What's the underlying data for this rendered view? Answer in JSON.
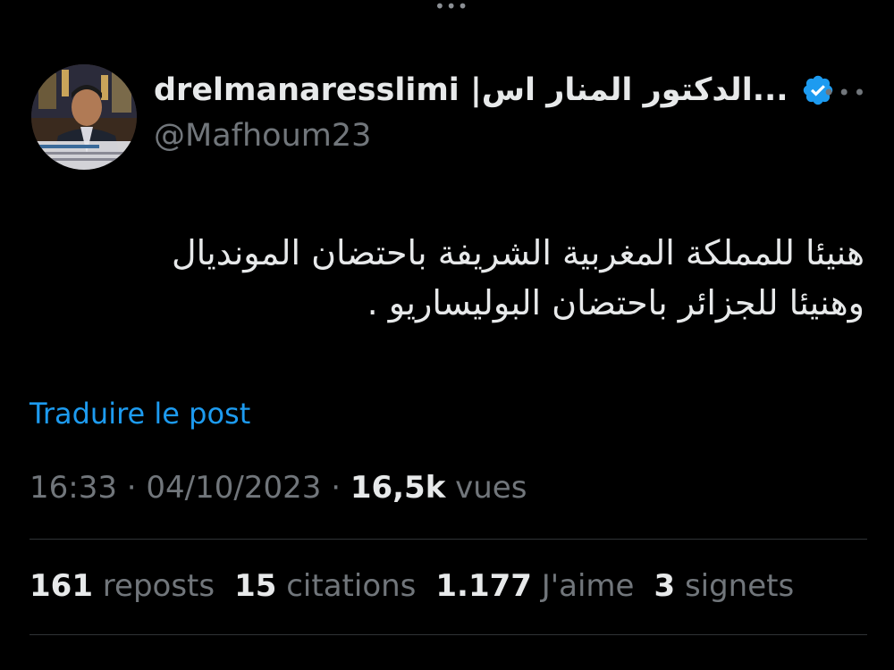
{
  "top_indicator": "•••",
  "author": {
    "display_name": "drelmanaresslimi |الدكتور المنار اس...",
    "handle": "@Mafhoum23",
    "verified": true,
    "verified_color": "#1d9bf0"
  },
  "more_menu": "•••",
  "tweet": {
    "lines": [
      "هنيئا للمملكة المغربية الشريفة باحتضان المونديال",
      "وهنيئا للجزائر باحتضان البوليساريو ."
    ]
  },
  "translate_label": "Traduire le post",
  "meta": {
    "time": "16:33",
    "separator": "·",
    "date": "04/10/2023",
    "views_count": "16,5k",
    "views_label": "vues"
  },
  "stats": {
    "reposts": {
      "count": "161",
      "label": "reposts"
    },
    "quotes": {
      "count": "15",
      "label": "citations"
    },
    "likes": {
      "count": "1.177",
      "label": "J'aime"
    },
    "bookmarks": {
      "count": "3",
      "label": "signets"
    }
  },
  "colors": {
    "background": "#000000",
    "text": "#e7e9ea",
    "muted": "#71767b",
    "link": "#1d9bf0",
    "divider": "#2f3336"
  }
}
